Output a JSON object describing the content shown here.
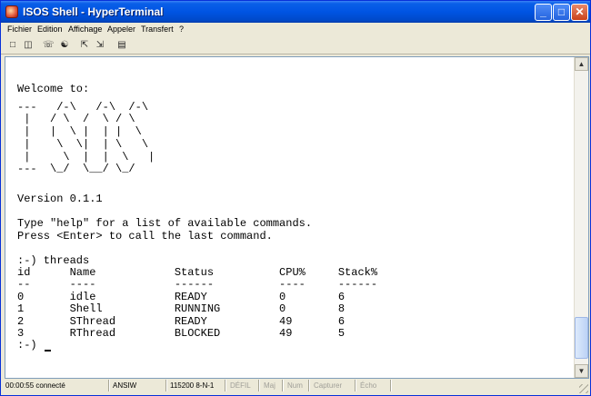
{
  "window": {
    "title": "ISOS Shell - HyperTerminal"
  },
  "titlebar_buttons": {
    "minimize": "_",
    "maximize": "□",
    "close": "✕"
  },
  "menu": [
    "Fichier",
    "Edition",
    "Affichage",
    "Appeler",
    "Transfert",
    "?"
  ],
  "toolbar": [
    "new-file-icon",
    "open-folder-icon",
    "phone-icon",
    "disconnect-icon",
    "send-icon",
    "receive-icon",
    "properties-icon"
  ],
  "terminal": {
    "lines": [
      "Welcome to:",
      "---   /-\\   /-\\  /-\\",
      " |   / \\  /  \\ / \\",
      " |   |  \\ |  | |  \\",
      " |    \\  \\|  | \\   \\",
      " |     \\  |  |  \\   |",
      "---  \\_/  \\__/ \\_/",
      "Version 0.1.1",
      "Type \"help\" for a list of available commands.",
      "Press <Enter> to call the last command.",
      ":-) threads",
      "id      Name            Status          CPU%     Stack%",
      "--      ----            ------          ----     ------",
      "0       idle            READY           0        6",
      "1       Shell           RUNNING         0        8",
      "2       SThread         READY           49       6",
      "3       RThread         BLOCKED         49       5",
      ":-) "
    ]
  },
  "status": {
    "connected": "00:00:55 connecté",
    "emulation": "ANSIW",
    "settings": "115200 8-N-1",
    "scroll": "DÉFIL",
    "caps": "Maj",
    "num": "Num",
    "capture": "Capturer",
    "echo": "Écho"
  }
}
